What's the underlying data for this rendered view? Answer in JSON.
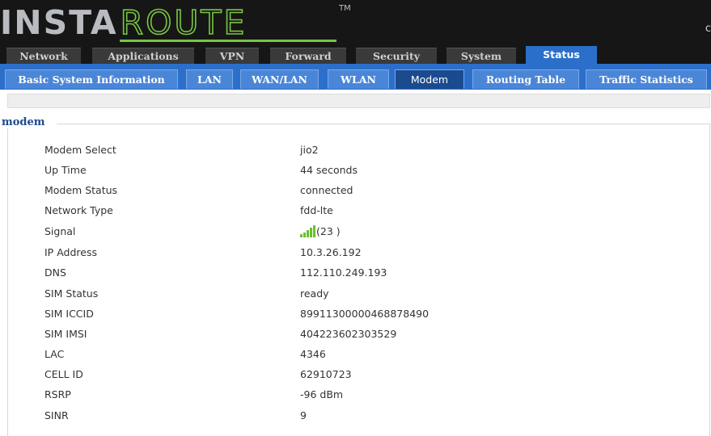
{
  "brand": {
    "part1": "INSTA",
    "part2": "ROUTE",
    "trademark": "TM",
    "header_glyph": "c"
  },
  "tabs": [
    {
      "label": "Network"
    },
    {
      "label": "Applications"
    },
    {
      "label": "VPN"
    },
    {
      "label": "Forward"
    },
    {
      "label": "Security"
    },
    {
      "label": "System"
    },
    {
      "label": "Status",
      "active": true
    }
  ],
  "subtabs": [
    {
      "label": "Basic System Information"
    },
    {
      "label": "LAN"
    },
    {
      "label": "WAN/LAN"
    },
    {
      "label": "WLAN"
    },
    {
      "label": "Modem",
      "active": true
    },
    {
      "label": "Routing Table"
    },
    {
      "label": "Traffic Statistics"
    }
  ],
  "section": {
    "title": "modem"
  },
  "modem": {
    "modem_select": {
      "label": "Modem Select",
      "value": "jio2"
    },
    "up_time": {
      "label": "Up Time",
      "value": "44 seconds"
    },
    "modem_status": {
      "label": "Modem Status",
      "value": "connected"
    },
    "network_type": {
      "label": "Network Type",
      "value": "fdd-lte"
    },
    "signal": {
      "label": "Signal",
      "value": "(23 )",
      "icon": "signal-bars-icon"
    },
    "ip_address": {
      "label": "IP Address",
      "value": "10.3.26.192"
    },
    "dns": {
      "label": "DNS",
      "value": "112.110.249.193"
    },
    "sim_status": {
      "label": "SIM Status",
      "value": "ready"
    },
    "sim_iccid": {
      "label": "SIM ICCID",
      "value": "89911300000468878490"
    },
    "sim_imsi": {
      "label": "SIM IMSI",
      "value": "404223602303529"
    },
    "lac": {
      "label": "LAC",
      "value": "4346"
    },
    "cell_id": {
      "label": "CELL ID",
      "value": "62910723"
    },
    "rsrp": {
      "label": "RSRP",
      "value": "-96 dBm"
    },
    "sinr": {
      "label": "SINR",
      "value": "9"
    }
  },
  "colors": {
    "accent": "#2b6fca",
    "brand_green": "#78c542",
    "header_bg": "#161616"
  }
}
